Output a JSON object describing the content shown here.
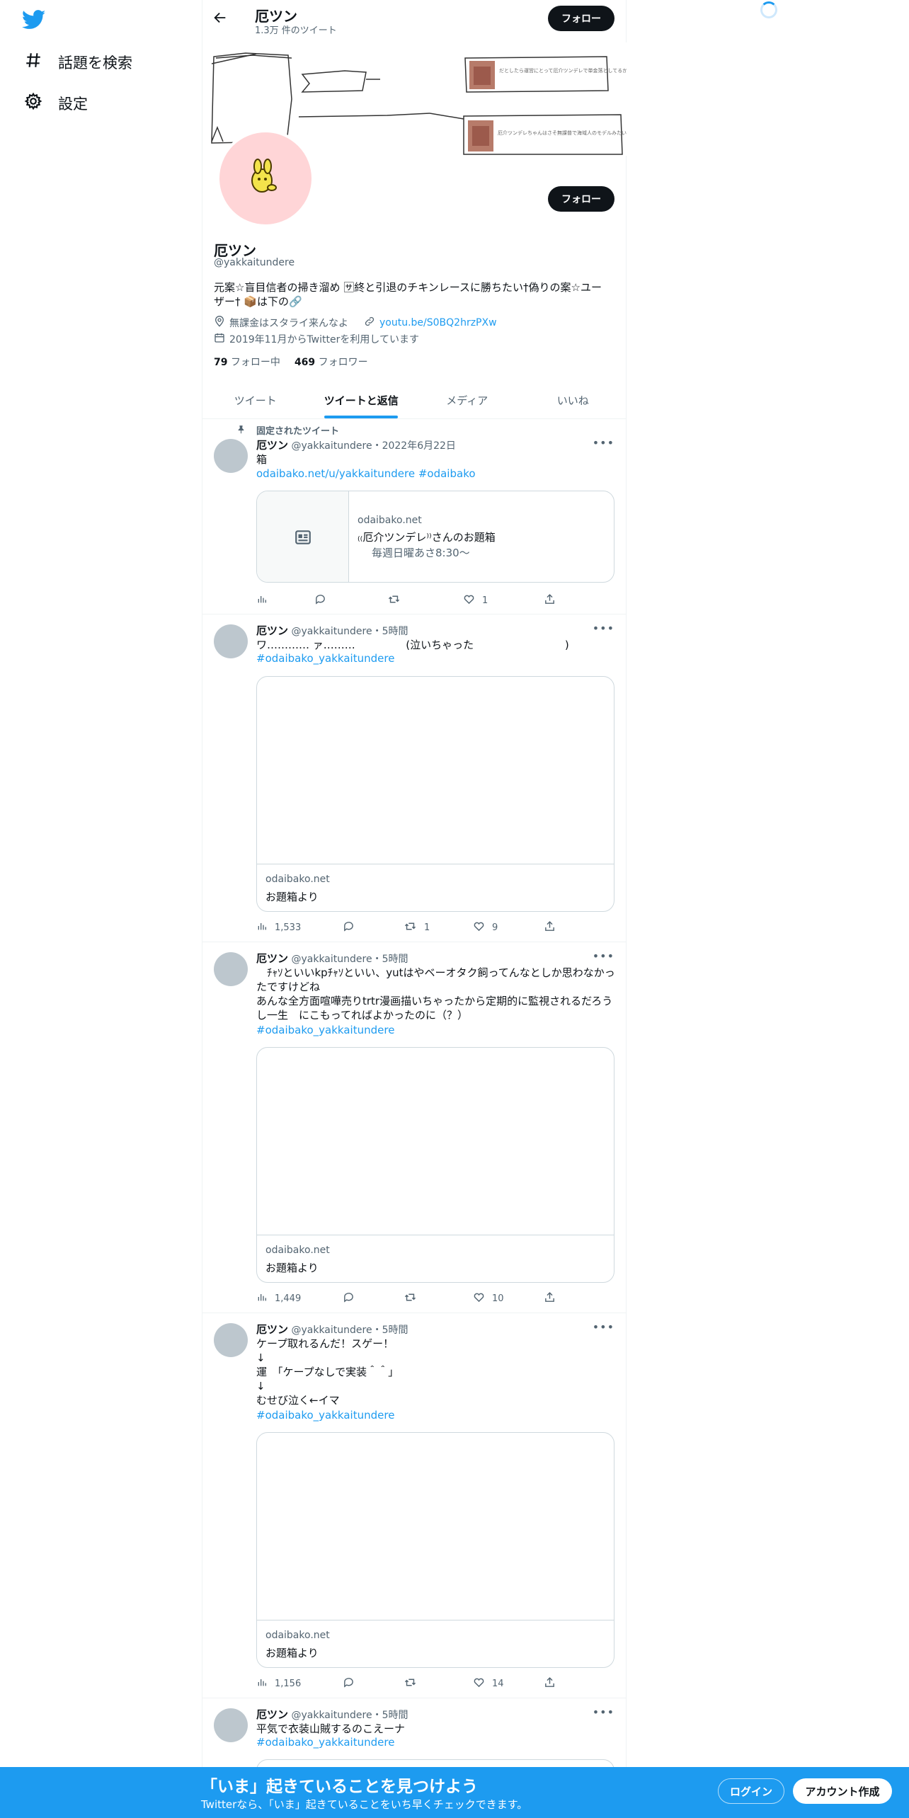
{
  "nav": {
    "items": [
      {
        "label": "話題を検索",
        "icon": "hashtag-icon"
      },
      {
        "label": "設定",
        "icon": "gear-icon"
      }
    ]
  },
  "header": {
    "title": "厄ツン",
    "subtitle": "1.3万 件のツイート",
    "follow_label": "フォロー"
  },
  "profile": {
    "name": "厄ツン",
    "handle": "@yakkaitundere",
    "bio_line1": "元案☆盲目信者の掃き溜め 🈂終と引退のチキンレースに勝ちたい†偽りの案☆ユー",
    "bio_line2": "ザー† 📦は下の🔗",
    "location": "無課金はスタライ来んなよ",
    "website": "youtu.be/S0BQ2hrzPXw",
    "joined": "2019年11月からTwitterを利用しています",
    "following_count": "79",
    "following_label": "フォロー中",
    "followers_count": "469",
    "followers_label": "フォロワー",
    "follow_label": "フォロー",
    "banner_text1": "だとしたら運営にとって厄介ツンデレで単金落としてるから運営に嫌はないか…笑",
    "banner_text2": "厄介ツンデレちゃんはさそ無課普で海域人のモデルみたいな展示なるんだろうね"
  },
  "tabs": [
    {
      "label": "ツイート",
      "active": false
    },
    {
      "label": "ツイートと返信",
      "active": true
    },
    {
      "label": "メディア",
      "active": false
    },
    {
      "label": "いいね",
      "active": false
    }
  ],
  "tweets": [
    {
      "pinned_label": "固定されたツイート",
      "name": "厄ツン",
      "meta": "@yakkaitundere・2022年6月22日",
      "text": "箱",
      "link": "odaibako.net/u/yakkaitundere #odaibako",
      "card_domain": "odaibako.net",
      "card_title": "₍₍厄介ツンデレ⁾⁾さんのお題箱",
      "card_desc": "毎週日曜あさ8:30〜",
      "views": "",
      "replies": "",
      "retweets": "",
      "likes": "1"
    },
    {
      "name": "厄ツン",
      "meta": "@yakkaitundere・5時間",
      "text": "ワ………… ァ………               (泣いちゃった                           )",
      "tag": "#odaibako_yakkaitundere",
      "card_domain": "odaibako.net",
      "card_title": "お題箱より",
      "views": "1,533",
      "replies": "",
      "retweets": "1",
      "likes": "9"
    },
    {
      "name": "厄ツン",
      "meta": "@yakkaitundere・5時間",
      "text": "　ﾁｬｿといいkpﾁｬｿといい、yutはやベーオタク飼ってんなとしか思わなかったですけどね\nあんな全方面喧嘩売りtrtr漫画描いちゃったから定期的に監視されるだろうし一生　にこもってればよかったのに（？）",
      "tag": "#odaibako_yakkaitundere",
      "card_domain": "odaibako.net",
      "card_title": "お題箱より",
      "views": "1,449",
      "replies": "",
      "retweets": "",
      "likes": "10"
    },
    {
      "name": "厄ツン",
      "meta": "@yakkaitundere・5時間",
      "text": "ケープ取れるんだ！スゲー！\n↓\n運　「ケープなしで実装＾＾」\n↓\nむせび泣く←イマ",
      "tag": "#odaibako_yakkaitundere",
      "card_domain": "odaibako.net",
      "card_title": "お題箱より",
      "views": "1,156",
      "replies": "",
      "retweets": "",
      "likes": "14"
    },
    {
      "name": "厄ツン",
      "meta": "@yakkaitundere・5時間",
      "text": "平気で衣装山賊するのこえーナ",
      "tag": "#odaibako_yakkaitundere"
    }
  ],
  "bottom_bar": {
    "title": "「いま」起きていることを見つけよう",
    "subtitle": "Twitterなら、「いま」起きていることをいち早くチェックできます。",
    "login_label": "ログイン",
    "signup_label": "アカウント作成"
  },
  "colors": {
    "accent": "#1d9bf0",
    "text": "#0f1419",
    "muted": "#536471",
    "avatar_bg": "#ffd5d7"
  }
}
